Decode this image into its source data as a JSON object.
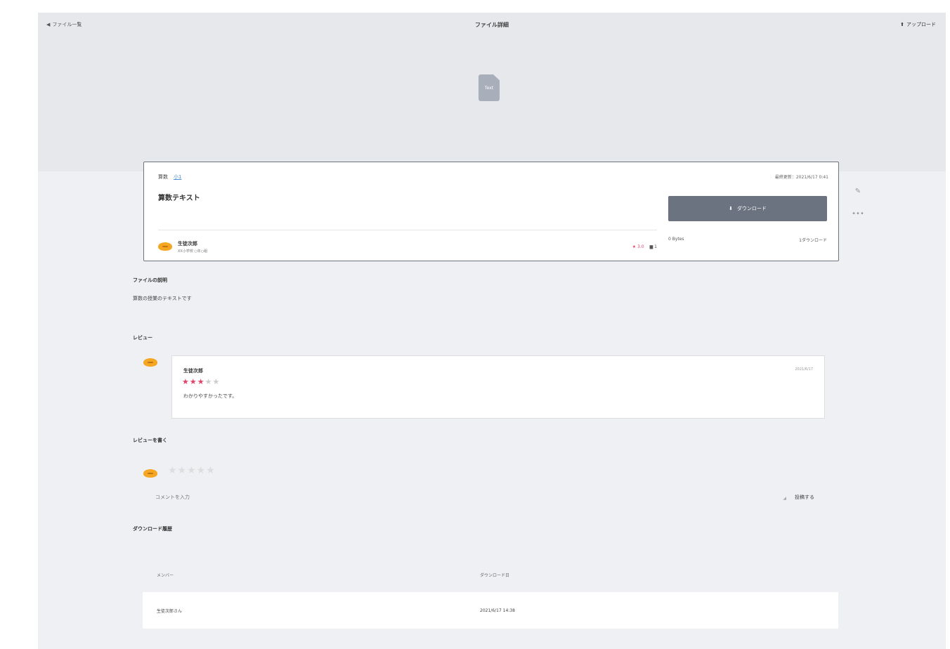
{
  "header": {
    "back_label": "ファイル一覧",
    "title": "ファイル詳細",
    "upload_label": "アップロード"
  },
  "file": {
    "type_label": "Text",
    "subject": "算数",
    "grade": "小1",
    "title": "算数テキスト",
    "owner_name": "生徒次郎",
    "owner_school": "ⅩⅩ小学校 ○年○組",
    "rating": "3.0",
    "comment_count": "1",
    "updated": "最終更新：2021/6/17 0:41",
    "download_label": "ダウンロード",
    "size": "0 Bytes",
    "download_count": "1ダウンロード"
  },
  "description": {
    "heading": "ファイルの説明",
    "text": "算数の授業のテキストです"
  },
  "reviews": {
    "heading": "レビュー",
    "items": [
      {
        "name": "生徒次郎",
        "stars_on": "★★★",
        "stars_off": "★★",
        "text": "わかりやすかったです。",
        "date": "2021/6/17"
      }
    ]
  },
  "write_review": {
    "heading": "レビューを書く",
    "stars": "★★★★★",
    "placeholder": "コメントを入力",
    "post_label": "投稿する"
  },
  "history": {
    "heading": "ダウンロード履歴",
    "columns": [
      "メンバー",
      "ダウンロード日"
    ],
    "rows": [
      {
        "member": "生徒次郎さん",
        "date": "2021/6/17 14:38"
      }
    ]
  },
  "icons": {
    "attach": "paperclip-icon",
    "more": "more-icon",
    "upload": "upload-icon",
    "download": "download-icon",
    "back": "chevron-left-icon"
  }
}
